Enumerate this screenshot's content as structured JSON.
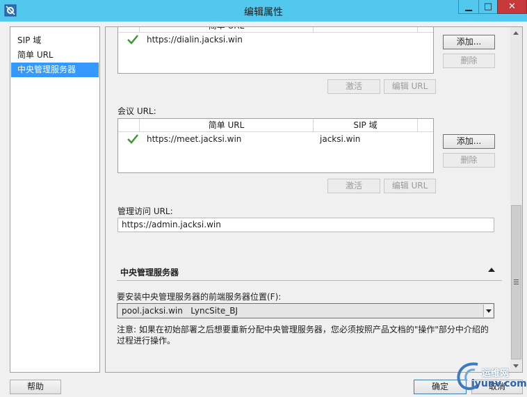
{
  "window": {
    "title": "编辑属性"
  },
  "nav": {
    "items": [
      "SIP 域",
      "简单 URL",
      "中央管理服务器"
    ],
    "selected_index": 2
  },
  "dialin_grid": {
    "headers": [
      "",
      "简单 URL",
      ""
    ],
    "rows": [
      {
        "url": "https://dialin.jacksi.win",
        "sip": ""
      }
    ]
  },
  "dialin_buttons": {
    "add": "添加...",
    "remove": "删除",
    "activate": "激活",
    "edit": "编辑 URL"
  },
  "meet": {
    "label": "会议 URL:",
    "headers": [
      "",
      "简单 URL",
      "SIP 域"
    ],
    "rows": [
      {
        "url": "https://meet.jacksi.win",
        "sip": "jacksi.win"
      }
    ],
    "buttons": {
      "add": "添加...",
      "remove": "删除",
      "activate": "激活",
      "edit": "编辑 URL"
    }
  },
  "admin": {
    "label": "管理访问 URL:",
    "value": "https://admin.jacksi.win"
  },
  "cms": {
    "section_title": "中央管理服务器",
    "select_label": "要安装中央管理服务器的前端服务器位置(F):",
    "selected_value": "pool.jacksi.win   LyncSite_BJ",
    "note_line1": "注意: 如果在初始部署之后想要重新分配中央管理服务器，您必须按照产品文档的\"操作\"部分中介绍的",
    "note_line2": "过程进行操作。"
  },
  "footer": {
    "help": "帮助",
    "ok": "确定",
    "cancel": "取消"
  },
  "watermark": {
    "line1": "运维网",
    "line2": "iyunv.com"
  },
  "colors": {
    "titlebar": "#52c8ee",
    "selection": "#3399ff",
    "close": "#c7383a",
    "check": "#3c9a2e"
  }
}
